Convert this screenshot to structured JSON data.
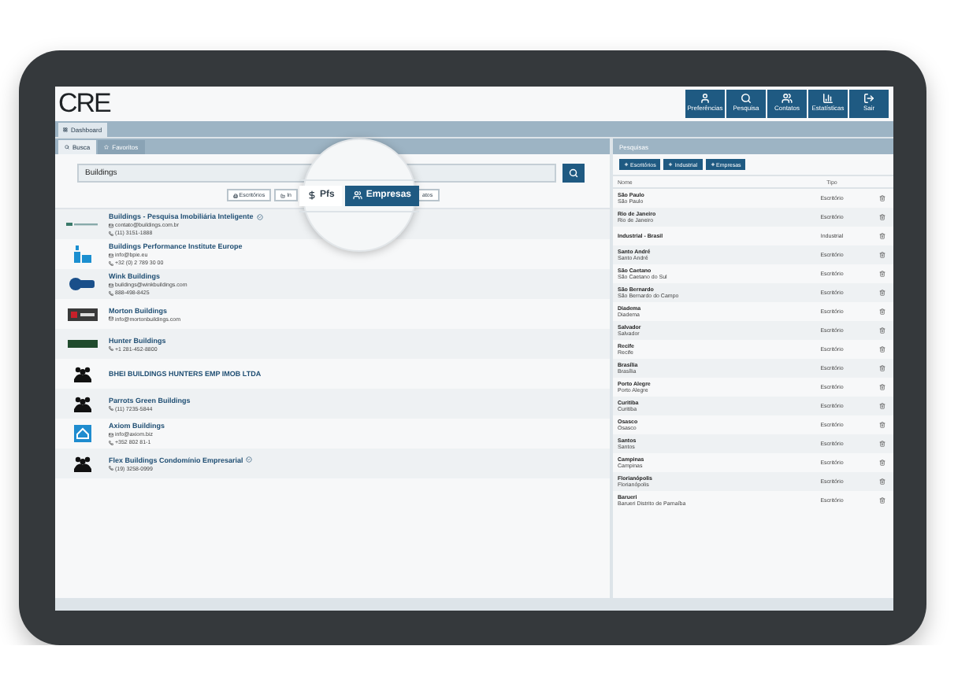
{
  "header": {
    "logo": "CRE",
    "nav": [
      {
        "label": "Preferências"
      },
      {
        "label": "Pesquisa"
      },
      {
        "label": "Contatos"
      },
      {
        "label": "Estatísticas"
      },
      {
        "label": "Sair"
      }
    ]
  },
  "tabs": [
    {
      "label": "Dashboard",
      "selected": true
    }
  ],
  "search_panel": {
    "tabs": [
      {
        "label": "Busca",
        "selected": true
      },
      {
        "label": "Favoritos",
        "selected": false
      }
    ],
    "search": {
      "value": "Buildings"
    },
    "filters": [
      {
        "label": "Escritórios",
        "selected": false
      },
      {
        "label": "In",
        "selected": false
      },
      {
        "label": "atos",
        "selected": false
      }
    ],
    "magnifier": {
      "filters": [
        {
          "label": "Pfs",
          "selected": false
        },
        {
          "label": "Empresas",
          "selected": true
        }
      ]
    },
    "results": [
      {
        "name": "Buildings - Pesquisa Imobiliária Inteligente",
        "kind": "wordmark",
        "verified": true,
        "email": "contato@buildings.com.br",
        "phone": "(11) 3151-1888"
      },
      {
        "name": "Buildings Performance Institute Europe",
        "kind": "tile",
        "verified": false,
        "email": "info@bpie.eu",
        "phone": "+32 (0) 2 789 30 00"
      },
      {
        "name": "Wink Buildings",
        "kind": "blob",
        "verified": false,
        "email": "buildings@winkbuildings.com",
        "phone": "888-498-8425"
      },
      {
        "name": "Morton Buildings",
        "kind": "banner",
        "verified": false,
        "email": "info@mortonbuildings.com"
      },
      {
        "name": "Hunter Buildings",
        "kind": "bar",
        "verified": false,
        "phone": "+1 281-452-8800"
      },
      {
        "name": "BHEI BUILDINGS HUNTERS EMP IMOB LTDA",
        "kind": "group",
        "verified": false
      },
      {
        "name": "Parrots Green Buildings",
        "kind": "group",
        "verified": false,
        "phone": "(11) 7235-5844"
      },
      {
        "name": "Axiom Buildings",
        "kind": "house",
        "verified": false,
        "email": "info@axiom.biz",
        "phone": "+352 802 81-1"
      },
      {
        "name": "Flex Buildings Condomínio Empresarial",
        "kind": "group",
        "verified": true,
        "phone": "(19) 3258-0999"
      }
    ]
  },
  "saved_panel": {
    "title": "Pesquisas",
    "buttons": [
      {
        "label": "Escritórios"
      },
      {
        "label": "Industrial"
      },
      {
        "label": "Empresas"
      }
    ],
    "columns": [
      "Nome",
      "Tipo"
    ],
    "rows": [
      {
        "name": "São Paulo",
        "subtitle": "São Paulo",
        "type": "Escritório"
      },
      {
        "name": "Rio de Janeiro",
        "subtitle": "Rio de Janeiro",
        "type": "Escritório"
      },
      {
        "name": "Industrial - Brasil",
        "type": "Industrial"
      },
      {
        "name": "Santo André",
        "subtitle": "Santo André",
        "type": "Escritório"
      },
      {
        "name": "São Caetano",
        "subtitle": "São Caetano do Sul",
        "type": "Escritório"
      },
      {
        "name": "São Bernardo",
        "subtitle": "São Bernardo do Campo",
        "type": "Escritório"
      },
      {
        "name": "Diadema",
        "subtitle": "Diadema",
        "type": "Escritório"
      },
      {
        "name": "Salvador",
        "subtitle": "Salvador",
        "type": "Escritório"
      },
      {
        "name": "Recife",
        "subtitle": "Recife",
        "type": "Escritório"
      },
      {
        "name": "Brasília",
        "subtitle": "Brasília",
        "type": "Escritório"
      },
      {
        "name": "Porto Alegre",
        "subtitle": "Porto Alegre",
        "type": "Escritório"
      },
      {
        "name": "Curitiba",
        "subtitle": "Curitiba",
        "type": "Escritório"
      },
      {
        "name": "Osasco",
        "subtitle": "Osasco",
        "type": "Escritório"
      },
      {
        "name": "Santos",
        "subtitle": "Santos",
        "type": "Escritório"
      },
      {
        "name": "Campinas",
        "subtitle": "Campinas",
        "type": "Escritório"
      },
      {
        "name": "Florianópolis",
        "subtitle": "Florianópolis",
        "type": "Escritório"
      },
      {
        "name": "Barueri",
        "subtitle": "Barueri Distrito de Parnaíba",
        "type": "Escritório"
      }
    ]
  }
}
